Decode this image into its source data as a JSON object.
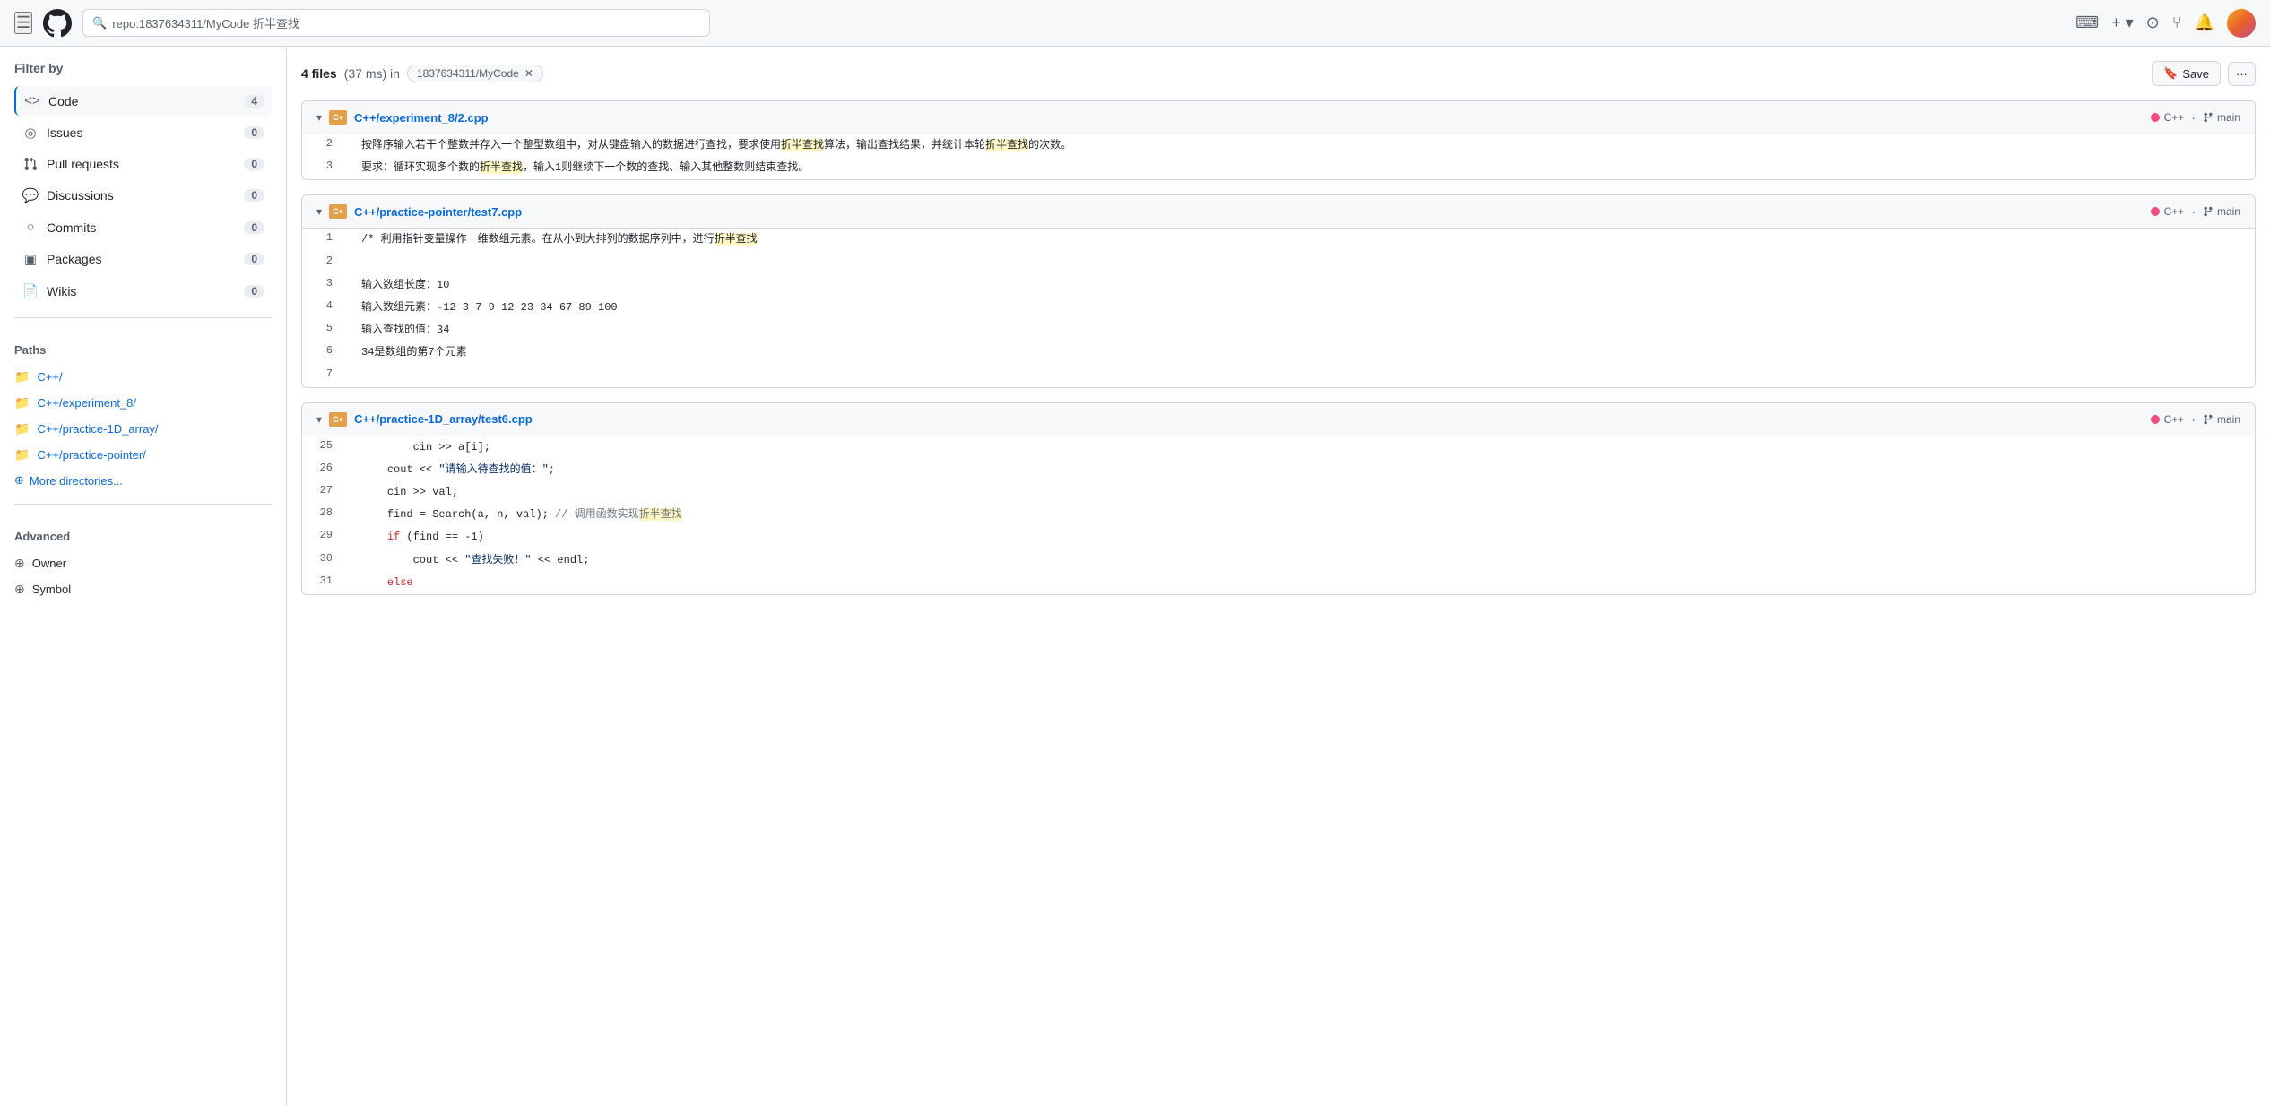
{
  "nav": {
    "search_text": "repo:1837634311/MyCode 折半查找",
    "search_repo_part": "repo:1837634311/MyCode",
    "search_query_part": " 折半查找"
  },
  "sidebar": {
    "title": "Filter by",
    "filters": [
      {
        "id": "code",
        "icon": "<>",
        "label": "Code",
        "count": "4",
        "active": true
      },
      {
        "id": "issues",
        "icon": "◎",
        "label": "Issues",
        "count": "0",
        "active": false
      },
      {
        "id": "pull-requests",
        "icon": "⑂",
        "label": "Pull requests",
        "count": "0",
        "active": false
      },
      {
        "id": "discussions",
        "icon": "☐",
        "label": "Discussions",
        "count": "0",
        "active": false
      },
      {
        "id": "commits",
        "icon": "○",
        "label": "Commits",
        "count": "0",
        "active": false
      },
      {
        "id": "packages",
        "icon": "▣",
        "label": "Packages",
        "count": "0",
        "active": false
      },
      {
        "id": "wikis",
        "icon": "📄",
        "label": "Wikis",
        "count": "0",
        "active": false
      }
    ],
    "paths_title": "Paths",
    "paths": [
      {
        "label": "C++/"
      },
      {
        "label": "C++/experiment_8/"
      },
      {
        "label": "C++/practice-1D_array/"
      },
      {
        "label": "C++/practice-pointer/"
      }
    ],
    "more_dirs_label": "More directories...",
    "advanced_title": "Advanced",
    "advanced_items": [
      {
        "label": "Owner"
      },
      {
        "label": "Symbol"
      }
    ]
  },
  "results": {
    "count": "4 files",
    "time": "(37 ms) in",
    "repo": "1837634311/MyCode",
    "save_label": "Save",
    "more_label": "···"
  },
  "files": [
    {
      "path": "C++/experiment_8/2.cpp",
      "lang": "C++",
      "branch": "main",
      "lines": [
        {
          "num": "2",
          "content": "按降序输入若干个整数并存入一个整型数组中，对从键盘输入的数据进行查找，要求使用",
          "highlight": "折半查找",
          "content_after": "算法，输出查找结果，并统计本轮",
          "highlight2": "折半查找",
          "content_end": "的次数。"
        },
        {
          "num": "3",
          "content": "要求：循环实现多个数的",
          "highlight": "折半查找",
          "content_after": "，输入1则继续下一个数的查找、输入其他整数则结束查找。"
        }
      ]
    },
    {
      "path": "C++/practice-pointer/test7.cpp",
      "lang": "C++",
      "branch": "main",
      "lines": [
        {
          "num": "1",
          "content": "/* 利用指针变量操作一维数组元素。在从小到大排列的数据序列中，进行",
          "highlight": "折半查找",
          "content_after": ""
        },
        {
          "num": "2",
          "content": ""
        },
        {
          "num": "3",
          "content": "输入数组长度：10"
        },
        {
          "num": "4",
          "content": "输入数组元素：-12 3 7 9 12 23 34 67 89 100"
        },
        {
          "num": "5",
          "content": "输入查找的值：34"
        },
        {
          "num": "6",
          "content": "34是数组的第7个元素"
        },
        {
          "num": "7",
          "content": ""
        }
      ]
    },
    {
      "path": "C++/practice-1D_array/test6.cpp",
      "lang": "C++",
      "branch": "main",
      "lines": [
        {
          "num": "25",
          "content": "        cin >> a[i];"
        },
        {
          "num": "26",
          "content": "    cout << \"请输入待查找的值：\";"
        },
        {
          "num": "27",
          "content": "    cin >> val;"
        },
        {
          "num": "28",
          "content": "    find = Search(a, n, val); // 调用函数实现",
          "highlight": "折半查找",
          "content_after": ""
        },
        {
          "num": "29",
          "content_keyword": "    if",
          "content": " (find == -1)"
        },
        {
          "num": "30",
          "content": "        cout << \"查找失败！\" << endl;"
        },
        {
          "num": "31",
          "content_keyword": "    else",
          "is_keyword": true
        }
      ]
    }
  ]
}
